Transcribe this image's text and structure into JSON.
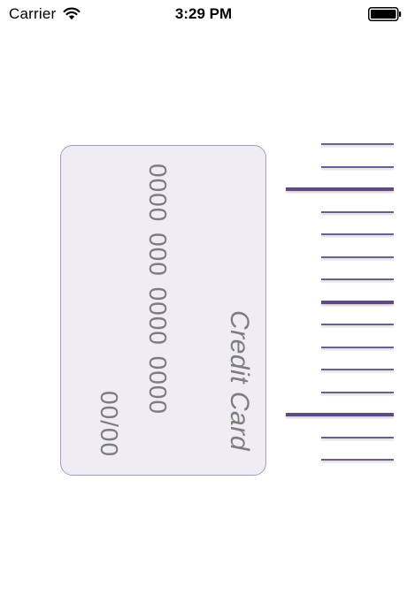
{
  "status_bar": {
    "carrier": "Carrier",
    "time": "3:29 PM",
    "wifi_icon": "wifi-icon",
    "battery_icon": "battery-full-icon"
  },
  "card": {
    "title": "Credit Card",
    "number_placeholder": "0000 000 0000 0000",
    "expiry_placeholder": "00/00"
  },
  "ruler": {
    "ticks": [
      "minor",
      "minor",
      "major",
      "minor",
      "minor",
      "minor",
      "minor",
      "medium",
      "minor",
      "minor",
      "minor",
      "minor",
      "major",
      "minor",
      "minor"
    ],
    "color": "#5f4a86"
  },
  "colors": {
    "card_border": "#a49cc2",
    "card_background": "#efedf3",
    "card_text": "#7d7d7d"
  }
}
